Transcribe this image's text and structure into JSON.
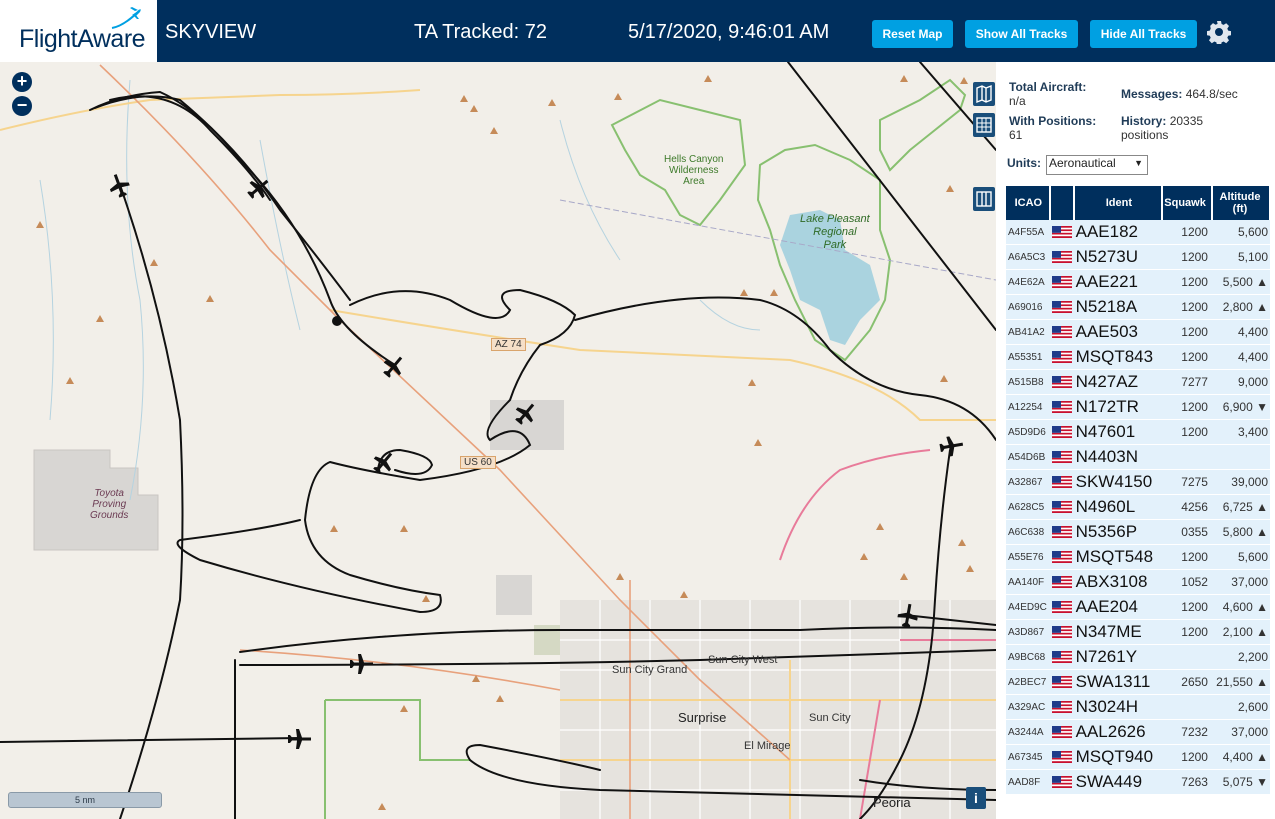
{
  "header": {
    "logo_text": "FlightAware",
    "app_name": "SKYVIEW",
    "tracked": "TA Tracked: 72",
    "datetime": "5/17/2020, 9:46:01 AM",
    "buttons": [
      "Reset Map",
      "Show All Tracks",
      "Hide All Tracks"
    ]
  },
  "stats": {
    "total_label": "Total Aircraft:",
    "total_value": "n/a",
    "positions_label": "With Positions:",
    "positions_value": "61",
    "messages_label": "Messages:",
    "messages_value": "464.8/sec",
    "history_label": "History:",
    "history_value": "20335",
    "history_unit": "positions"
  },
  "units": {
    "label": "Units:",
    "selected": "Aeronautical"
  },
  "table": {
    "headers": [
      "ICAO",
      "",
      "Ident",
      "Squawk",
      "Altitude (ft)"
    ],
    "rows": [
      {
        "icao": "A4F55A",
        "ident": "AAE182",
        "squawk": "1200",
        "alt": "5,600"
      },
      {
        "icao": "A6A5C3",
        "ident": "N5273U",
        "squawk": "1200",
        "alt": "5,100"
      },
      {
        "icao": "A4E62A",
        "ident": "AAE221",
        "squawk": "1200",
        "alt": "5,500 ▲"
      },
      {
        "icao": "A69016",
        "ident": "N5218A",
        "squawk": "1200",
        "alt": "2,800 ▲"
      },
      {
        "icao": "AB41A2",
        "ident": "AAE503",
        "squawk": "1200",
        "alt": "4,400"
      },
      {
        "icao": "A55351",
        "ident": "MSQT843",
        "squawk": "1200",
        "alt": "4,400"
      },
      {
        "icao": "A515B8",
        "ident": "N427AZ",
        "squawk": "7277",
        "alt": "9,000"
      },
      {
        "icao": "A12254",
        "ident": "N172TR",
        "squawk": "1200",
        "alt": "6,900 ▼"
      },
      {
        "icao": "A5D9D6",
        "ident": "N47601",
        "squawk": "1200",
        "alt": "3,400"
      },
      {
        "icao": "A54D6B",
        "ident": "N4403N",
        "squawk": "",
        "alt": ""
      },
      {
        "icao": "A32867",
        "ident": "SKW4150",
        "squawk": "7275",
        "alt": "39,000"
      },
      {
        "icao": "A628C5",
        "ident": "N4960L",
        "squawk": "4256",
        "alt": "6,725 ▲"
      },
      {
        "icao": "A6C638",
        "ident": "N5356P",
        "squawk": "0355",
        "alt": "5,800 ▲"
      },
      {
        "icao": "A55E76",
        "ident": "MSQT548",
        "squawk": "1200",
        "alt": "5,600"
      },
      {
        "icao": "AA140F",
        "ident": "ABX3108",
        "squawk": "1052",
        "alt": "37,000"
      },
      {
        "icao": "A4ED9C",
        "ident": "AAE204",
        "squawk": "1200",
        "alt": "4,600 ▲"
      },
      {
        "icao": "A3D867",
        "ident": "N347ME",
        "squawk": "1200",
        "alt": "2,100 ▲"
      },
      {
        "icao": "A9BC68",
        "ident": "N7261Y",
        "squawk": "",
        "alt": "2,200"
      },
      {
        "icao": "A2BEC7",
        "ident": "SWA1311",
        "squawk": "2650",
        "alt": "21,550 ▲"
      },
      {
        "icao": "A329AC",
        "ident": "N3024H",
        "squawk": "",
        "alt": "2,600"
      },
      {
        "icao": "A3244A",
        "ident": "AAL2626",
        "squawk": "7232",
        "alt": "37,000"
      },
      {
        "icao": "A67345",
        "ident": "MSQT940",
        "squawk": "1200",
        "alt": "4,400 ▲"
      },
      {
        "icao": "AAD8F",
        "ident": "SWA449",
        "squawk": "7263",
        "alt": "5,075 ▼"
      }
    ]
  },
  "map": {
    "scale": "5 nm",
    "labels": {
      "hells_canyon": [
        "Hells Canyon",
        "Wilderness",
        "Area"
      ],
      "lake_pleasant": [
        "Lake Pleasant",
        "Regional",
        "Park"
      ],
      "toyota": [
        "Toyota",
        "Proving",
        "Grounds"
      ],
      "az74": "AZ 74",
      "us60": "US 60",
      "sun_city_grand": "Sun City Grand",
      "sun_city_west": "Sun City West",
      "surprise": "Surprise",
      "sun_city": "Sun City",
      "el_mirage": "El Mirage",
      "peoria": "Peoria"
    },
    "colors": {
      "track": "#111111",
      "header": "#002f5d",
      "button": "#00a0e2",
      "water": "#aad3df",
      "park": "#6fb04e",
      "road": "#e8a17c"
    }
  }
}
